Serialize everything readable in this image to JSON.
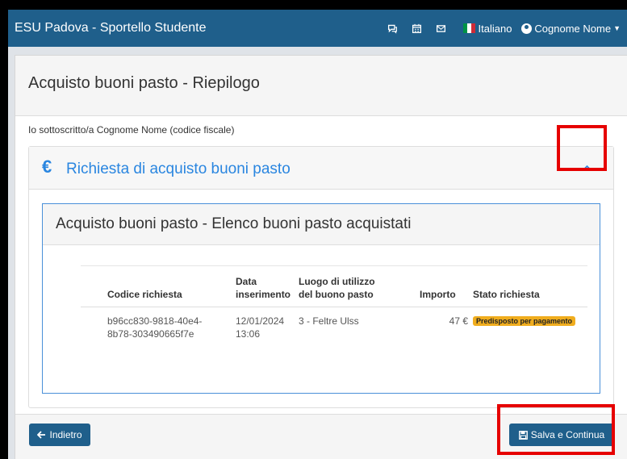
{
  "navbar": {
    "brand": "ESU Padova - Sportello Studente",
    "language": "Italiano",
    "user": "Cognome Nome",
    "icons": [
      "chat-icon",
      "calendar-icon",
      "mail-icon",
      "italy-flag-icon",
      "user-circle-icon"
    ]
  },
  "page": {
    "title": "Acquisto buoni pasto - Riepilogo",
    "intro": "Io sottoscritto/a Cognome Nome (codice fiscale)"
  },
  "panel": {
    "symbol": "€",
    "title": "Richiesta di acquisto buoni pasto"
  },
  "inner": {
    "title": "Acquisto buoni pasto - Elenco buoni pasto acquistati",
    "headers": {
      "code": "Codice richiesta",
      "date_1": "Data",
      "date_2": "inserimento",
      "place_1": "Luogo di utilizzo",
      "place_2": "del buono pasto",
      "amount": "Importo",
      "status": "Stato richiesta"
    },
    "rows": [
      {
        "code_1": "b96cc830-9818-40e4-",
        "code_2": "8b78-303490665f7e",
        "date_1": "12/01/2024",
        "date_2": "13:06",
        "place": "3 - Feltre Ulss",
        "amount": "47 €",
        "status": "Predisposto per pagamento"
      }
    ]
  },
  "footer": {
    "back_label": "Indietro",
    "save_label": "Salva e Continua"
  },
  "colors": {
    "navbar": "#1f5f8b",
    "link": "#2a86e0",
    "badge": "#f0ad1e",
    "highlight": "#e60000"
  }
}
